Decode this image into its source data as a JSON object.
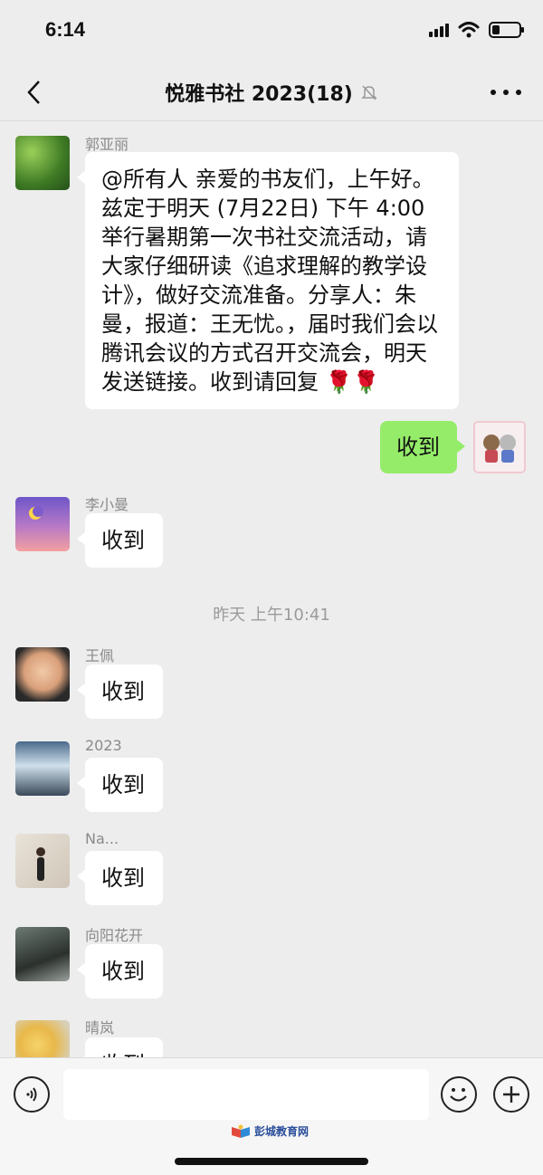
{
  "status_bar": {
    "time": "6:14"
  },
  "header": {
    "title": "悦雅书社 2023(18)"
  },
  "messages": [
    {
      "sender": "郭亚丽",
      "text": "@所有人 亲爱的书友们，上午好。兹定于明天 (7月22日) 下午 4:00举行暑期第一次书社交流活动，请大家仔细研读《追求理解的教学设计》，做好交流准备。分享人：朱曼，报道：王无忧。，届时我们会以腾讯会议的方式召开交流会，明天发送链接。收到请回复"
    },
    {
      "sender": "",
      "text": "收到"
    },
    {
      "sender": "李小曼",
      "text": "收到"
    },
    {
      "sender": "王佩",
      "text": "收到"
    },
    {
      "sender": "2023",
      "text": "收到"
    },
    {
      "sender": "Na...",
      "text": "收到"
    },
    {
      "sender": "向阳花开",
      "text": "收到"
    },
    {
      "sender": "晴岚",
      "text": "收到"
    }
  ],
  "timestamp": "昨天 上午10:41",
  "input_bar": {
    "placeholder": ""
  },
  "watermark": {
    "text": "彭城教育网"
  },
  "colors": {
    "background": "#ededed",
    "own_bubble": "#95ec69",
    "other_bubble": "#ffffff"
  },
  "icons": [
    "back-chevron-icon",
    "mute-bell-icon",
    "more-icon",
    "voice-icon",
    "emoji-icon",
    "plus-icon",
    "rose-icon"
  ]
}
